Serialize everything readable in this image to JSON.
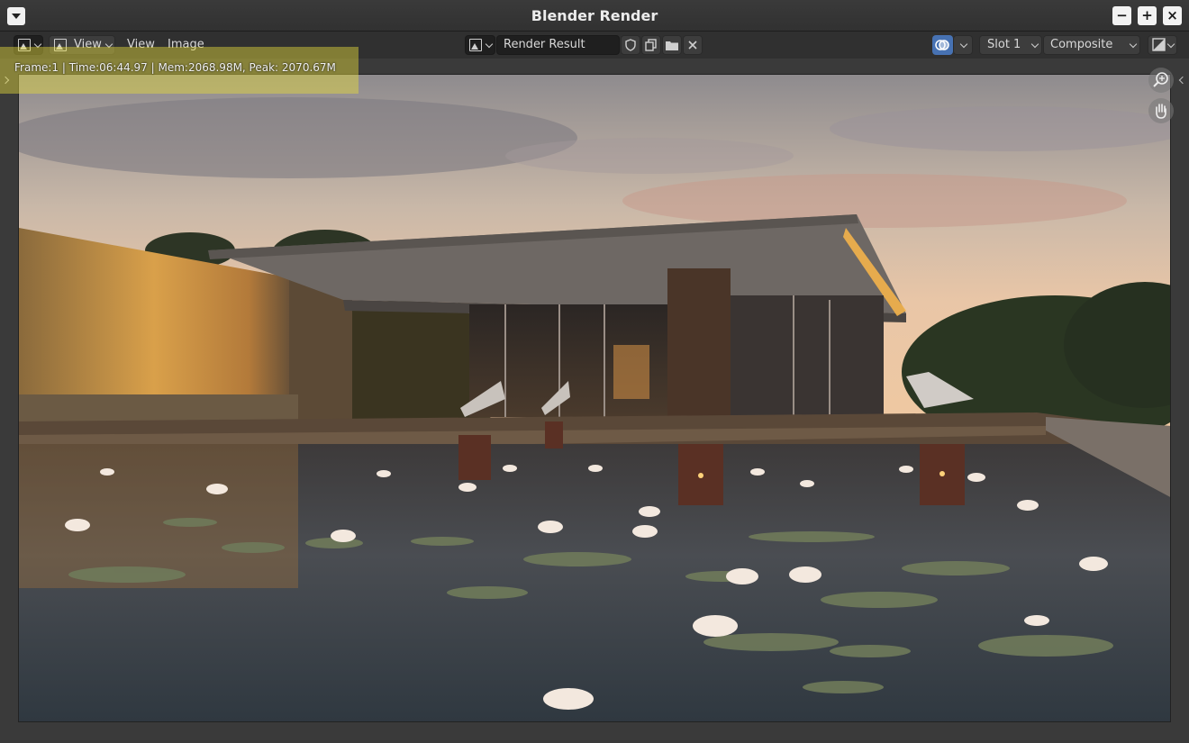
{
  "window": {
    "title": "Blender Render",
    "minimize": "−",
    "maximize": "+",
    "close": "×"
  },
  "header": {
    "view_menu_label": "View",
    "view_label": "View",
    "image_label": "Image",
    "image_name": "Render Result",
    "slot": "Slot 1",
    "layer": "Composite"
  },
  "info": {
    "text": "Frame:1 | Time:06:44.97 | Mem:2068.98M, Peak: 2070.67M"
  },
  "colors": {
    "accent_blue": "#4772b3",
    "highlight": "#e6dc3c"
  }
}
